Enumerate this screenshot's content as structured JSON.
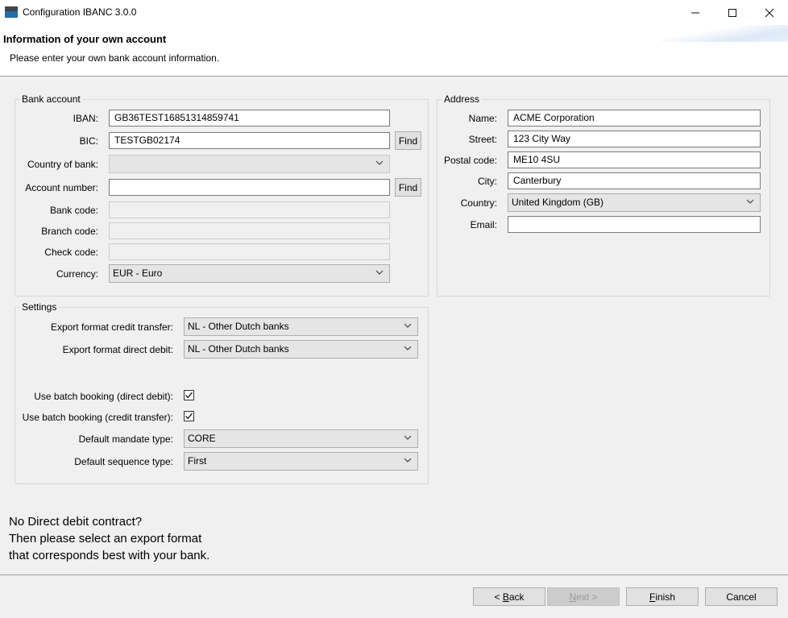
{
  "window": {
    "title": "Configuration IBANC 3.0.0",
    "minimize": "—",
    "maximize": "☐",
    "close": "✕"
  },
  "header": {
    "title": "Information of your own account",
    "subtitle": "Please enter your own bank account information."
  },
  "bank_account": {
    "group_title": "Bank account",
    "iban_label": "IBAN:",
    "iban_value": "GB36TEST16851314859741",
    "bic_label": "BIC:",
    "bic_value": "TESTGB02174",
    "find_label": "Find",
    "country_label": "Country of bank:",
    "country_value": "",
    "account_label": "Account number:",
    "account_value": "",
    "bank_code_label": "Bank code:",
    "branch_code_label": "Branch code:",
    "check_code_label": "Check code:",
    "currency_label": "Currency:",
    "currency_value": "EUR - Euro"
  },
  "address": {
    "group_title": "Address",
    "name_label": "Name:",
    "name_value": "ACME Corporation",
    "street_label": "Street:",
    "street_value": "123 City Way",
    "postal_label": "Postal code:",
    "postal_value": "ME10 4SU",
    "city_label": "City:",
    "city_value": "Canterbury",
    "country_label": "Country:",
    "country_value": "United Kingdom (GB)",
    "email_label": "Email:",
    "email_value": ""
  },
  "settings": {
    "group_title": "Settings",
    "credit_transfer_label": "Export format credit transfer:",
    "credit_transfer_value": "NL - Other Dutch banks",
    "direct_debit_label": "Export format direct debit:",
    "direct_debit_value": "NL - Other Dutch banks",
    "batch_dd_label": "Use batch booking (direct debit):",
    "batch_dd_checked": true,
    "batch_ct_label": "Use batch booking (credit transfer):",
    "batch_ct_checked": true,
    "mandate_label": "Default mandate type:",
    "mandate_value": "CORE",
    "sequence_label": "Default sequence type:",
    "sequence_value": "First"
  },
  "hint": {
    "line1": "No Direct debit contract?",
    "line2": "Then please select an export format",
    "line3": "that corresponds best with your bank."
  },
  "footer": {
    "back_prefix": "< ",
    "back_key": "B",
    "back_rest": "ack",
    "next_key": "N",
    "next_rest": "ext >",
    "finish_key": "F",
    "finish_rest": "inish",
    "cancel": "Cancel"
  }
}
